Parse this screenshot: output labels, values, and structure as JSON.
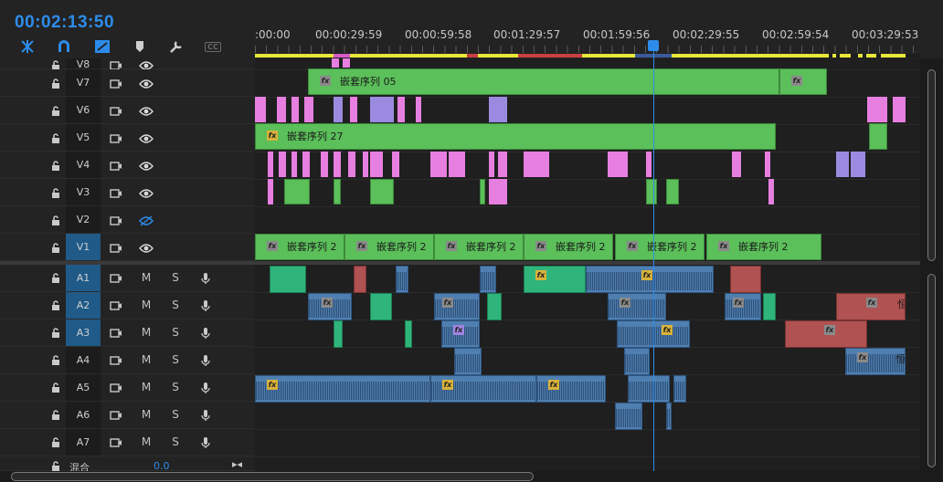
{
  "timecode": "00:02:13:50",
  "tools": [
    "snap-icon",
    "magnet-icon",
    "linked-selection-icon",
    "marker-icon",
    "wrench-icon",
    "captions-icon"
  ],
  "captions_label": "CC",
  "ruler_labels": [
    ":00:00",
    "00:00:29:59",
    "00:00:59:58",
    "00:01:29:57",
    "00:01:59:56",
    "00:02:29:55",
    "00:02:59:54",
    "00:03:29:53"
  ],
  "video_tracks": [
    {
      "label": "V8",
      "visible": true
    },
    {
      "label": "V7",
      "visible": true
    },
    {
      "label": "V6",
      "visible": true
    },
    {
      "label": "V5",
      "visible": true
    },
    {
      "label": "V4",
      "visible": true
    },
    {
      "label": "V3",
      "visible": true
    },
    {
      "label": "V2",
      "visible": false
    },
    {
      "label": "V1",
      "visible": true
    }
  ],
  "audio_tracks": [
    {
      "label": "A1",
      "targeted": true
    },
    {
      "label": "A2",
      "targeted": true
    },
    {
      "label": "A3",
      "targeted": true
    },
    {
      "label": "A4",
      "targeted": false
    },
    {
      "label": "A5",
      "targeted": false
    },
    {
      "label": "A6",
      "targeted": false
    },
    {
      "label": "A7",
      "targeted": false
    }
  ],
  "mute_label": "M",
  "solo_label": "S",
  "mix_label": "混合",
  "mix_value": "0.0",
  "clips": {
    "v7_nest": "嵌套序列 05",
    "v5_nest": "嵌套序列 27",
    "v1_nest": "嵌套序列 2",
    "a_trunc": "恒"
  },
  "colors": {
    "accent": "#2d8ceb",
    "clip_green": "#5bbf5a",
    "clip_pink": "#e67fe0",
    "clip_lavender": "#9b8be0",
    "clip_audio_blue": "#4f7fb0",
    "clip_audio_green": "#2fb57c",
    "clip_audio_red": "#b05252",
    "work_area_yellow": "#e8e83a"
  }
}
